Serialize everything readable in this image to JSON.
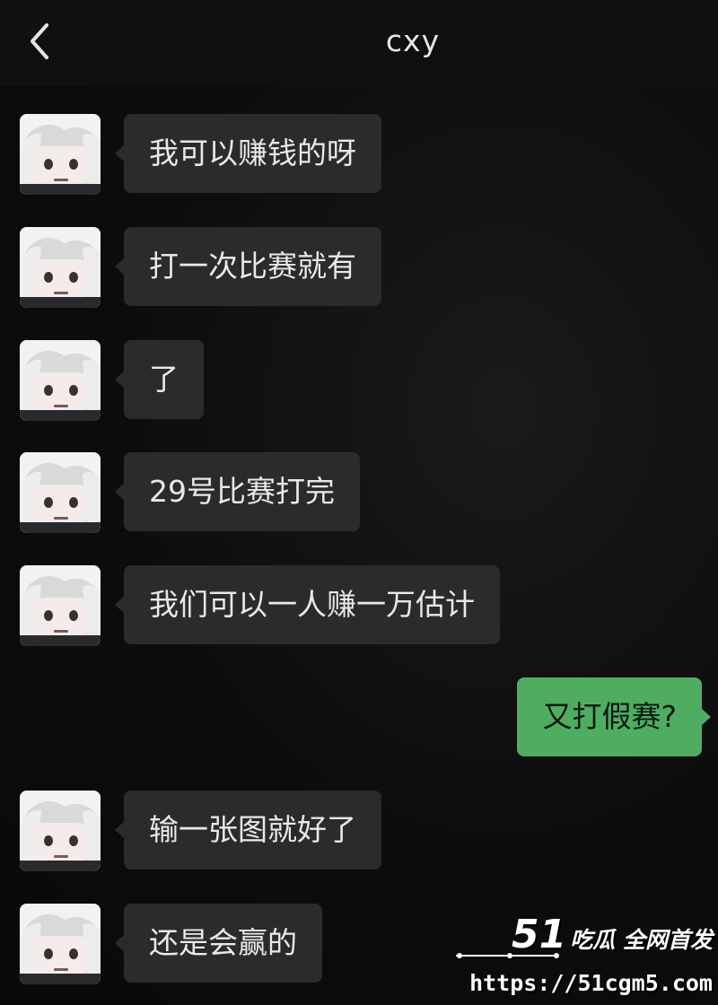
{
  "header": {
    "title": "cxy",
    "back_icon": "chevron-left-icon"
  },
  "colors": {
    "background": "#0d0d0d",
    "incoming_bubble": "#2b2b2b",
    "outgoing_bubble": "#4fad62"
  },
  "messages": [
    {
      "sender": "contact",
      "text": "我可以赚钱的呀"
    },
    {
      "sender": "contact",
      "text": "打一次比赛就有"
    },
    {
      "sender": "contact",
      "text": "了"
    },
    {
      "sender": "contact",
      "text": "29号比赛打完"
    },
    {
      "sender": "contact",
      "text": "我们可以一人赚一万估计"
    },
    {
      "sender": "me",
      "text": "又打假赛?"
    },
    {
      "sender": "contact",
      "text": "输一张图就好了"
    },
    {
      "sender": "contact",
      "text": "还是会赢的"
    }
  ],
  "watermark": {
    "number": "51",
    "text": "吃瓜 全网首发",
    "url": "https://51cgm5.com"
  }
}
